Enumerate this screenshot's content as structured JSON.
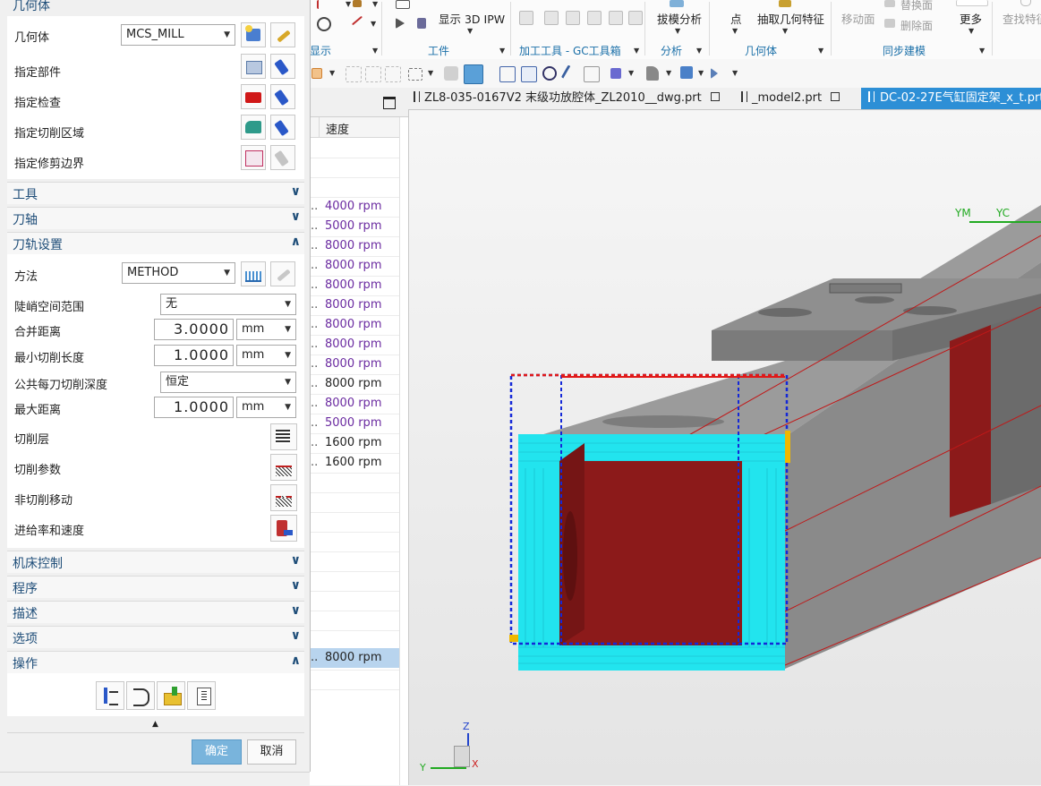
{
  "ribbon": {
    "display_3d_ipw": "显示 3D IPW",
    "draft_analysis": "拔模分析",
    "point": "点",
    "extract_geometry": "抽取几何特征",
    "move_face": "移动面",
    "replace_face": "替换面",
    "delete_face": "删除面",
    "more": "更多",
    "find_features": "查找特征",
    "groups": {
      "display": "显示",
      "workpiece": "工件",
      "toolbox": "加工工具 - GC工具箱",
      "analysis": "分析",
      "geometry": "几何体",
      "sync_modeling": "同步建模"
    }
  },
  "tabs": [
    {
      "label": "ZL8-035-0167V2 末级功放腔体_ZL2010__dwg.prt"
    },
    {
      "label": "_model2.prt"
    },
    {
      "label": "DC-02-27E气缸固定架_x_t.prt"
    }
  ],
  "navigator": {
    "column_speed": "速度",
    "rows": [
      {
        "dots": "",
        "speed": ""
      },
      {
        "dots": "",
        "speed": ""
      },
      {
        "dots": "",
        "speed": ""
      },
      {
        "dots": "..",
        "speed": "4000 rpm"
      },
      {
        "dots": "..",
        "speed": "5000 rpm"
      },
      {
        "dots": "..",
        "speed": "8000 rpm"
      },
      {
        "dots": "..",
        "speed": "8000 rpm"
      },
      {
        "dots": "..",
        "speed": "8000 rpm"
      },
      {
        "dots": "..",
        "speed": "8000 rpm"
      },
      {
        "dots": "..",
        "speed": "8000 rpm"
      },
      {
        "dots": "..",
        "speed": "8000 rpm"
      },
      {
        "dots": "..",
        "speed": "8000 rpm"
      },
      {
        "dots": "..",
        "speed": "8000 rpm"
      },
      {
        "dots": "..",
        "speed": "8000 rpm"
      },
      {
        "dots": "..",
        "speed": "5000 rpm"
      },
      {
        "dots": "..",
        "speed": "1600 rpm"
      },
      {
        "dots": "..",
        "speed": "1600 rpm"
      }
    ],
    "selected_row_speed": "8000 rpm",
    "selected_row_dots": ".."
  },
  "dialog": {
    "geometry_section": "几何体",
    "geometry_label": "几何体",
    "geometry_value": "MCS_MILL",
    "specify_part": "指定部件",
    "specify_check": "指定检查",
    "specify_cut_area": "指定切削区域",
    "specify_trim_boundary": "指定修剪边界",
    "tool_section": "工具",
    "axis_section": "刀轴",
    "path_settings_section": "刀轨设置",
    "method_label": "方法",
    "method_value": "METHOD",
    "steep_range_label": "陡峭空间范围",
    "steep_range_value": "无",
    "merge_distance_label": "合并距离",
    "merge_distance_value": "3.0000",
    "merge_distance_unit": "mm",
    "min_cut_length_label": "最小切削长度",
    "min_cut_length_value": "1.0000",
    "min_cut_length_unit": "mm",
    "common_depth_label": "公共每刀切削深度",
    "common_depth_value": "恒定",
    "max_distance_label": "最大距离",
    "max_distance_value": "1.0000",
    "max_distance_unit": "mm",
    "cut_levels_label": "切削层",
    "cut_params_label": "切削参数",
    "non_cut_moves_label": "非切削移动",
    "feeds_speeds_label": "进给率和速度",
    "machine_control_section": "机床控制",
    "program_section": "程序",
    "description_section": "描述",
    "options_section": "选项",
    "actions_section": "操作",
    "ok_label": "确定",
    "cancel_label": "取消"
  },
  "triad": {
    "ym": "YM",
    "yc": "YC",
    "z": "Z",
    "y": "Y",
    "x": "X"
  },
  "colors": {
    "accent": "#2d8fd6",
    "section_text": "#1f4e79",
    "toolpath": "#20e0ec",
    "face_red": "#8c1a1a",
    "ok_button": "#79b4dc"
  }
}
